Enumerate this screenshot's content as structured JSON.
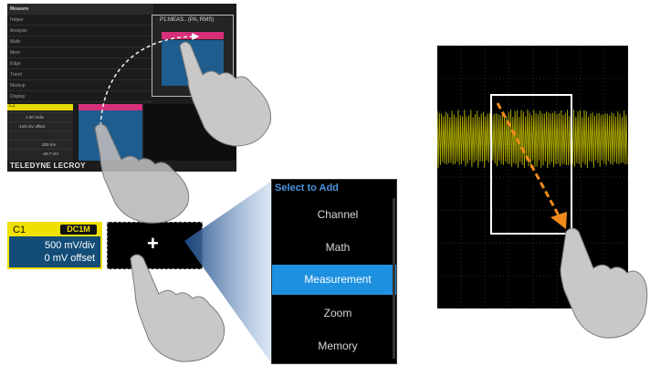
{
  "panel_screenshot": {
    "menu_rows": [
      "Measure",
      "Helper",
      "Analysis",
      "Math",
      "Mem",
      "Edge",
      "Trend",
      "Markup",
      "Display"
    ],
    "dialog_title": "P1:MEAS.. (PA, RMS)",
    "brand": "TELEDYNE LECROY",
    "channel_label": "C1",
    "descriptor_rows": [
      "1.00 V/div",
      "-120 mV offset",
      "",
      "200 mV",
      "-40.7 mV"
    ]
  },
  "channel_tile": {
    "name": "C1",
    "coupling": "DC1M",
    "scale": "500 mV/div",
    "offset": "0 mV offset",
    "accent_color": "#f0e000",
    "body_color": "#124c77"
  },
  "add_tile": {
    "plus": "+"
  },
  "add_menu": {
    "title": "Select to Add",
    "items": [
      "Channel",
      "Math",
      "Measurement",
      "Zoom",
      "Memory"
    ],
    "selected": "Measurement",
    "highlight_color": "#1e90e0"
  },
  "scope": {
    "trace_color": "#c9c700",
    "grid_color": "#3a3a3a"
  }
}
